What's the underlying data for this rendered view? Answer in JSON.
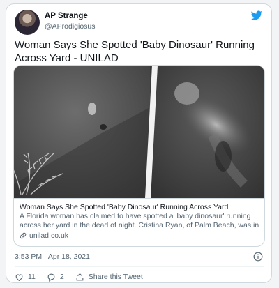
{
  "author": {
    "name": "AP Strange",
    "handle": "@AProdigiosus"
  },
  "tweet": {
    "text": "Woman Says She Spotted 'Baby Dinosaur' Running Across Yard - UNILAD",
    "timestamp": "3:53 PM · Apr 18, 2021"
  },
  "card": {
    "title": "Woman Says She Spotted 'Baby Dinosaur' Running Across Yard",
    "description": "A Florida woman has claimed to have spotted a 'baby dinosaur' running across her yard in the dead of night. Cristina Ryan, of Palm Beach, was in ...",
    "domain": "unilad.co.uk"
  },
  "actions": {
    "likes": "11",
    "replies": "2",
    "share_label": "Share this Tweet"
  },
  "colors": {
    "twitter_blue": "#1d9bf0",
    "secondary_text": "#536471",
    "border": "#cfd9de"
  },
  "icons": [
    "twitter-logo-icon",
    "info-icon",
    "heart-icon",
    "reply-icon",
    "share-icon",
    "link-icon"
  ]
}
